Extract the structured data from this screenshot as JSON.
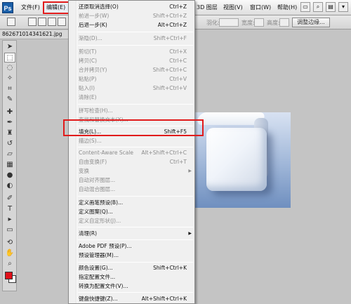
{
  "menubar": {
    "logo": "Ps",
    "items": {
      "file": "文件(F)",
      "edit": "编辑(E)",
      "layer3d": "3D 图层",
      "view": "视图(V)",
      "window": "窗口(W)",
      "help": "帮助(H)"
    }
  },
  "options": {
    "feather_label": "羽化:",
    "width_label": "宽度:",
    "height_label": "高度:",
    "refine_edge_button": "调整边缘..."
  },
  "document": {
    "tab_title": "862671014341621.jpg"
  },
  "colors": {
    "foreground": "#e0101a",
    "background": "#ffffff",
    "highlight_box": "#e11b1b"
  },
  "edit_menu": {
    "undo": {
      "label": "还原取消选择(O)",
      "shortcut": "Ctrl+Z"
    },
    "step_forward": {
      "label": "前进一步(W)",
      "shortcut": "Shift+Ctrl+Z"
    },
    "step_backward": {
      "label": "后退一步(K)",
      "shortcut": "Alt+Ctrl+Z"
    },
    "fade": {
      "label": "渐隐(D)...",
      "shortcut": "Shift+Ctrl+F"
    },
    "cut": {
      "label": "剪切(T)",
      "shortcut": "Ctrl+X"
    },
    "copy": {
      "label": "拷贝(C)",
      "shortcut": "Ctrl+C"
    },
    "copy_merged": {
      "label": "合并拷贝(Y)",
      "shortcut": "Shift+Ctrl+C"
    },
    "paste": {
      "label": "粘贴(P)",
      "shortcut": "Ctrl+V"
    },
    "paste_into": {
      "label": "贴入(I)",
      "shortcut": "Shift+Ctrl+V"
    },
    "clear": {
      "label": "清除(E)"
    },
    "spell_check": {
      "label": "拼写检查(H)..."
    },
    "find_replace": {
      "label": "查找和替换文本(X)..."
    },
    "fill": {
      "label": "填充(L)...",
      "shortcut": "Shift+F5"
    },
    "stroke": {
      "label": "描边(S)..."
    },
    "content_aware_scale": {
      "label": "Content-Aware Scale",
      "shortcut": "Alt+Shift+Ctrl+C"
    },
    "free_transform": {
      "label": "自由变换(F)",
      "shortcut": "Ctrl+T"
    },
    "transform": {
      "label": "变换"
    },
    "auto_align": {
      "label": "自动对齐图层..."
    },
    "auto_blend": {
      "label": "自动混合图层..."
    },
    "define_brush": {
      "label": "定义画笔预设(B)..."
    },
    "define_pattern": {
      "label": "定义图案(Q)..."
    },
    "define_shape": {
      "label": "定义自定形状(J)..."
    },
    "purge": {
      "label": "清理(R)"
    },
    "pdf_presets": {
      "label": "Adobe PDF 预设(P)..."
    },
    "preset_manager": {
      "label": "预设管理器(M)..."
    },
    "color_settings": {
      "label": "颜色设置(G)...",
      "shortcut": "Shift+Ctrl+K"
    },
    "assign_profile": {
      "label": "指定配置文件..."
    },
    "convert_profile": {
      "label": "转换为配置文件(V)..."
    },
    "keyboard_shortcuts": {
      "label": "键盘快捷键(Z)...",
      "shortcut": "Alt+Shift+Ctrl+K"
    }
  }
}
